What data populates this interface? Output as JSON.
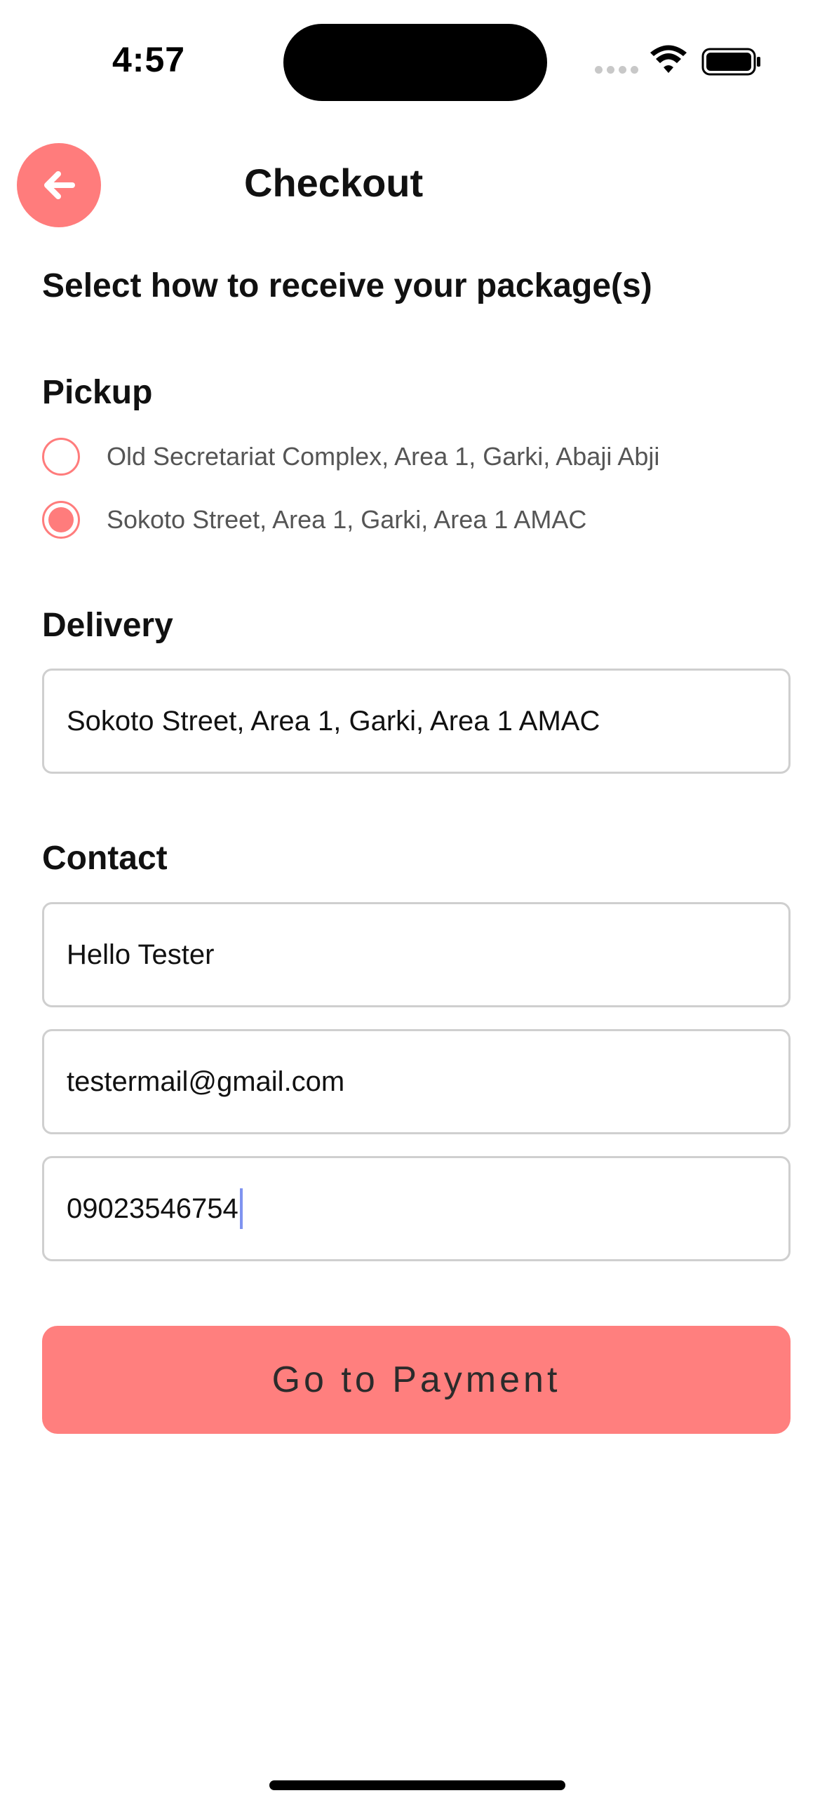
{
  "status_bar": {
    "time": "4:57"
  },
  "header": {
    "back_icon": "arrow-left-icon",
    "title": "Checkout"
  },
  "subtitle": "Select how to receive your package(s)",
  "pickup": {
    "label": "Pickup",
    "options": [
      {
        "text": "Old Secretariat Complex, Area 1, Garki, Abaji Abji",
        "selected": false
      },
      {
        "text": "Sokoto Street, Area 1, Garki, Area 1 AMAC",
        "selected": true
      }
    ]
  },
  "delivery": {
    "label": "Delivery",
    "address": "Sokoto Street, Area 1, Garki, Area 1 AMAC"
  },
  "contact": {
    "label": "Contact",
    "name": "Hello Tester",
    "email": "testermail@gmail.com",
    "phone": "09023546754"
  },
  "actions": {
    "pay_label": "Go to Payment"
  },
  "colors": {
    "accent": "#ff7c7c",
    "field_border": "#cfcfcf",
    "caret": "#7f93f0"
  }
}
